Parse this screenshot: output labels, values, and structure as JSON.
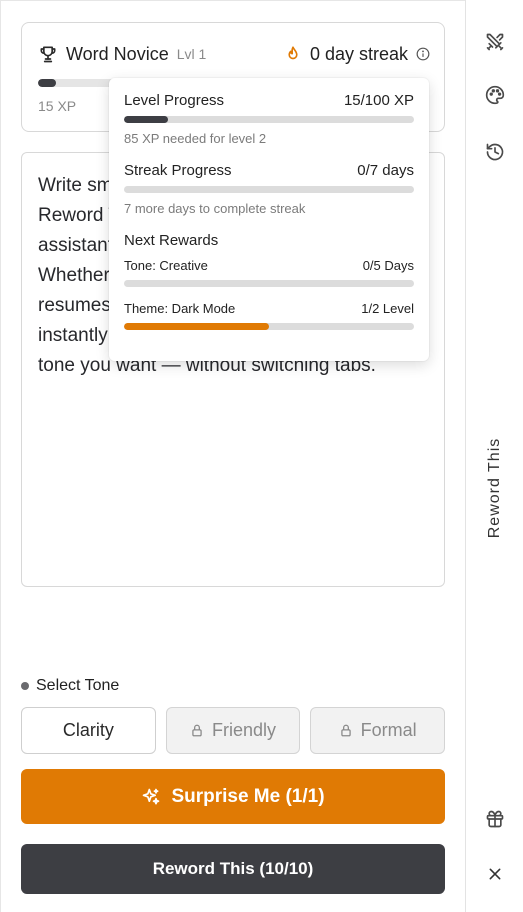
{
  "header": {
    "level_name": "Word Novice",
    "level_tag": "Lvl 1",
    "streak": "0 day streak",
    "xp": "15 XP",
    "xp_progress": 0.15
  },
  "editor": {
    "text": "Write smarter, faster, and with confidence. Reword This is your AI-powered writing assistant that fits right into your browser. Whether you're crafting emails, social posts, resumes, or essays, Reword This helps you instantly rephrase and refine text in the exact tone you want — without switching tabs."
  },
  "popover": {
    "level_progress": {
      "label": "Level Progress",
      "value": "15/100 XP",
      "note": "85 XP needed for level 2",
      "progress": 0.15,
      "color": "#3d3e44"
    },
    "streak_progress": {
      "label": "Streak Progress",
      "value": "0/7 days",
      "note": "7 more days to complete streak",
      "progress": 0
    },
    "rewards_title": "Next Rewards",
    "rewards": [
      {
        "label": "Tone: Creative",
        "value": "0/5 Days",
        "progress": 0,
        "color": "#e07a04"
      },
      {
        "label": "Theme: Dark Mode",
        "value": "1/2 Level",
        "progress": 0.5,
        "color": "#e07a04"
      }
    ]
  },
  "tone": {
    "label": "Select Tone",
    "options": [
      {
        "label": "Clarity",
        "locked": false
      },
      {
        "label": "Friendly",
        "locked": true
      },
      {
        "label": "Formal",
        "locked": true
      }
    ]
  },
  "actions": {
    "surprise_label": "Surprise Me (1/1)",
    "reword_label": "Reword This (10/10)"
  },
  "sidebar": {
    "title": "Reword This",
    "icons": [
      "swords-icon",
      "palette-icon",
      "history-icon",
      "gift-icon",
      "close-icon"
    ]
  },
  "colors": {
    "accent": "#e07a04",
    "dark": "#3d3e43"
  }
}
